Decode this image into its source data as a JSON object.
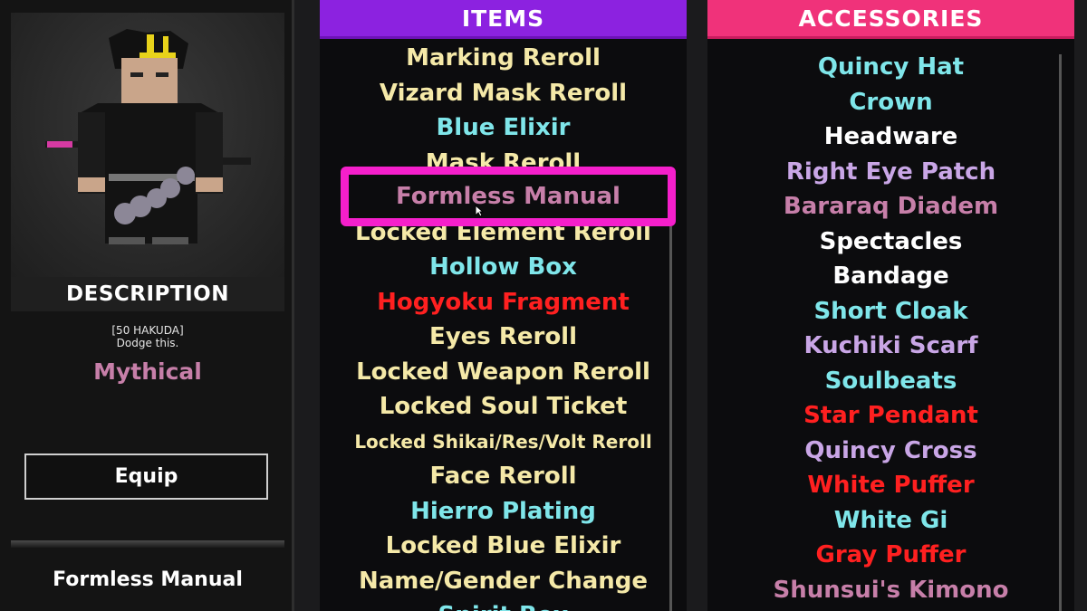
{
  "detail": {
    "header": "DESCRIPTION",
    "price": "[50 HAKUDA]",
    "description": "Dodge this.",
    "rarity": "Mythical",
    "rarity_color": "#c77fa9",
    "equip_label": "Equip",
    "selected_name": "Formless Manual"
  },
  "items": {
    "header": "ITEMS",
    "header_color": "#8c22e0",
    "list": [
      {
        "label": "Marking Reroll",
        "color": "#f5e9a8"
      },
      {
        "label": "Vizard Mask Reroll",
        "color": "#f5e9a8"
      },
      {
        "label": "Blue Elixir",
        "color": "#7fe6ea"
      },
      {
        "label": "Mask Reroll",
        "color": "#f5e9a8"
      },
      {
        "label": "Formless Manual",
        "color": "#c77fa9"
      },
      {
        "label": "Locked Element Reroll",
        "color": "#f5e9a8"
      },
      {
        "label": "Hollow Box",
        "color": "#7fe6ea"
      },
      {
        "label": "Hogyoku Fragment",
        "color": "#ff2020"
      },
      {
        "label": "Eyes Reroll",
        "color": "#f5e9a8"
      },
      {
        "label": "Locked Weapon Reroll",
        "color": "#f5e9a8"
      },
      {
        "label": "Locked Soul Ticket",
        "color": "#f5e9a8"
      },
      {
        "label": "Locked Shikai/Res/Volt Reroll",
        "color": "#f5e9a8",
        "small": true
      },
      {
        "label": "Face Reroll",
        "color": "#f5e9a8"
      },
      {
        "label": "Hierro Plating",
        "color": "#7fe6ea"
      },
      {
        "label": "Locked Blue Elixir",
        "color": "#f5e9a8"
      },
      {
        "label": "Name/Gender Change",
        "color": "#f5e9a8"
      },
      {
        "label": "Spirit Box",
        "color": "#7fe6ea"
      }
    ]
  },
  "accessories": {
    "header": "ACCESSORIES",
    "header_color": "#f0327a",
    "list": [
      {
        "label": "Quincy Hat",
        "color": "#7fe6ea"
      },
      {
        "label": "Crown",
        "color": "#7fe6ea"
      },
      {
        "label": "Headware",
        "color": "#ffffff"
      },
      {
        "label": "Right Eye Patch",
        "color": "#c9a6e6"
      },
      {
        "label": "Bararaq Diadem",
        "color": "#c77fa9"
      },
      {
        "label": "Spectacles",
        "color": "#ffffff"
      },
      {
        "label": "Bandage",
        "color": "#ffffff"
      },
      {
        "label": "Short Cloak",
        "color": "#7fe6ea"
      },
      {
        "label": "Kuchiki Scarf",
        "color": "#c9a6e6"
      },
      {
        "label": "Soulbeats",
        "color": "#7fe6ea"
      },
      {
        "label": "Star Pendant",
        "color": "#ff2020"
      },
      {
        "label": "Quincy Cross",
        "color": "#c9a6e6"
      },
      {
        "label": "White Puffer",
        "color": "#ff2020"
      },
      {
        "label": "White Gi",
        "color": "#7fe6ea"
      },
      {
        "label": "Gray Puffer",
        "color": "#ff2020"
      },
      {
        "label": "Shunsui's Kimono",
        "color": "#c77fa9"
      }
    ]
  },
  "selection": {
    "label": "Formless Manual",
    "border_color": "#f51fcb"
  }
}
